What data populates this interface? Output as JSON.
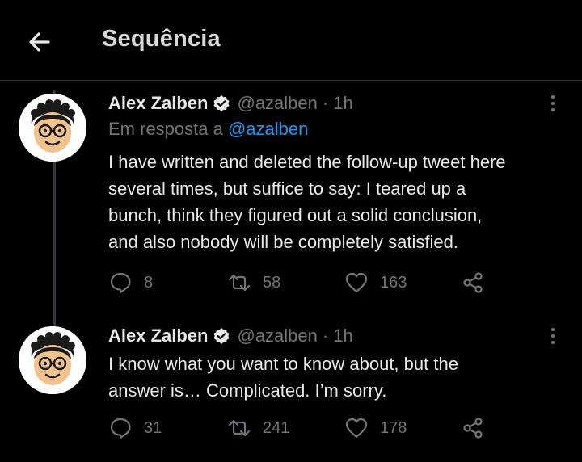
{
  "header": {
    "title": "Sequência"
  },
  "tweets": [
    {
      "name": "Alex Zalben",
      "handle": "@azalben",
      "separator": "·",
      "time": "1h",
      "reply_prefix": "Em resposta a",
      "reply_handle": "@azalben",
      "text": "I have written and deleted the follow-up tweet here\nseveral times, but suffice to say: I teared up a\nbunch, think they figured out a solid conclusion,\nand also nobody will be completely satisfied.",
      "replies": "8",
      "retweets": "58",
      "likes": "163"
    },
    {
      "name": "Alex Zalben",
      "handle": "@azalben",
      "separator": "·",
      "time": "1h",
      "text": "I know what you want to know about, but the\nanswer is… Complicated. I’m sorry.",
      "replies": "31",
      "retweets": "241",
      "likes": "178"
    }
  ],
  "colors": {
    "background": "#000000",
    "text": "#e7e9ea",
    "muted": "#71767b",
    "link": "#1d9bf0",
    "divider": "#2f3336"
  },
  "icons": [
    "back-arrow-icon",
    "verified-badge-icon",
    "more-options-icon",
    "reply-icon",
    "retweet-icon",
    "like-icon",
    "share-icon"
  ]
}
